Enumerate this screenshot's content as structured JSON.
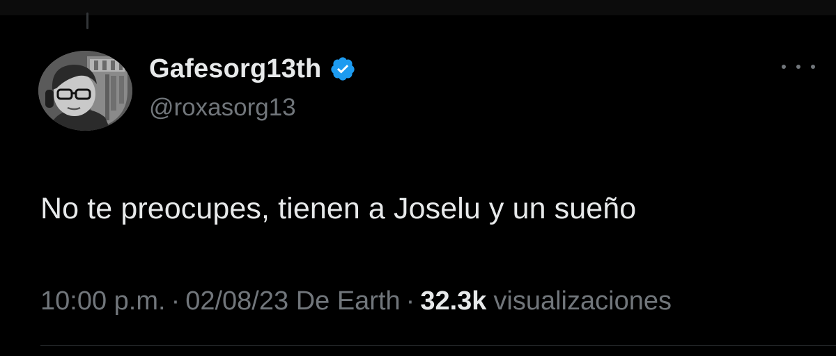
{
  "tweet": {
    "author": {
      "display_name": "Gafesorg13th",
      "handle": "@roxasorg13",
      "verified": true,
      "verified_icon": "verified-badge-icon"
    },
    "more_icon": "more-options-icon",
    "text": "No te preocupes, tienen a Joselu y un sueño",
    "meta": {
      "time": "10:00 p.m.",
      "separator": "·",
      "date_source": "02/08/23 De Earth",
      "views_count": "32.3k",
      "views_label": "visualizaciones"
    }
  },
  "colors": {
    "background": "#000000",
    "primary_text": "#e7e9ea",
    "secondary_text": "#71767b",
    "verified_blue": "#1d9bf0"
  }
}
